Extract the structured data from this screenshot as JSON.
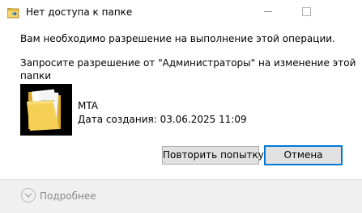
{
  "window": {
    "title": "Нет доступа к папке",
    "icon": "folder-move-icon",
    "controls": [
      "minimize-icon",
      "maximize-icon"
    ]
  },
  "message": {
    "line1": "Вам необходимо разрешение на выполнение этой операции.",
    "line2": "Запросите разрешение от \"Администраторы\" на изменение этой",
    "line3": "папки"
  },
  "item": {
    "icon": "folder-icon",
    "name": "MTA",
    "created": "Дата создания: 03.06.2025 11:09"
  },
  "buttons": {
    "retry": "Повторить попытку",
    "cancel": "Отмена"
  },
  "footer": {
    "details_label": "Подробнее",
    "icon": "chevron-down-circle-icon"
  },
  "colors": {
    "accent": "#0078d7",
    "button_bg": "#e1e1e1",
    "footer_bg": "#f0f0f0",
    "folder": "#f2c94c"
  }
}
